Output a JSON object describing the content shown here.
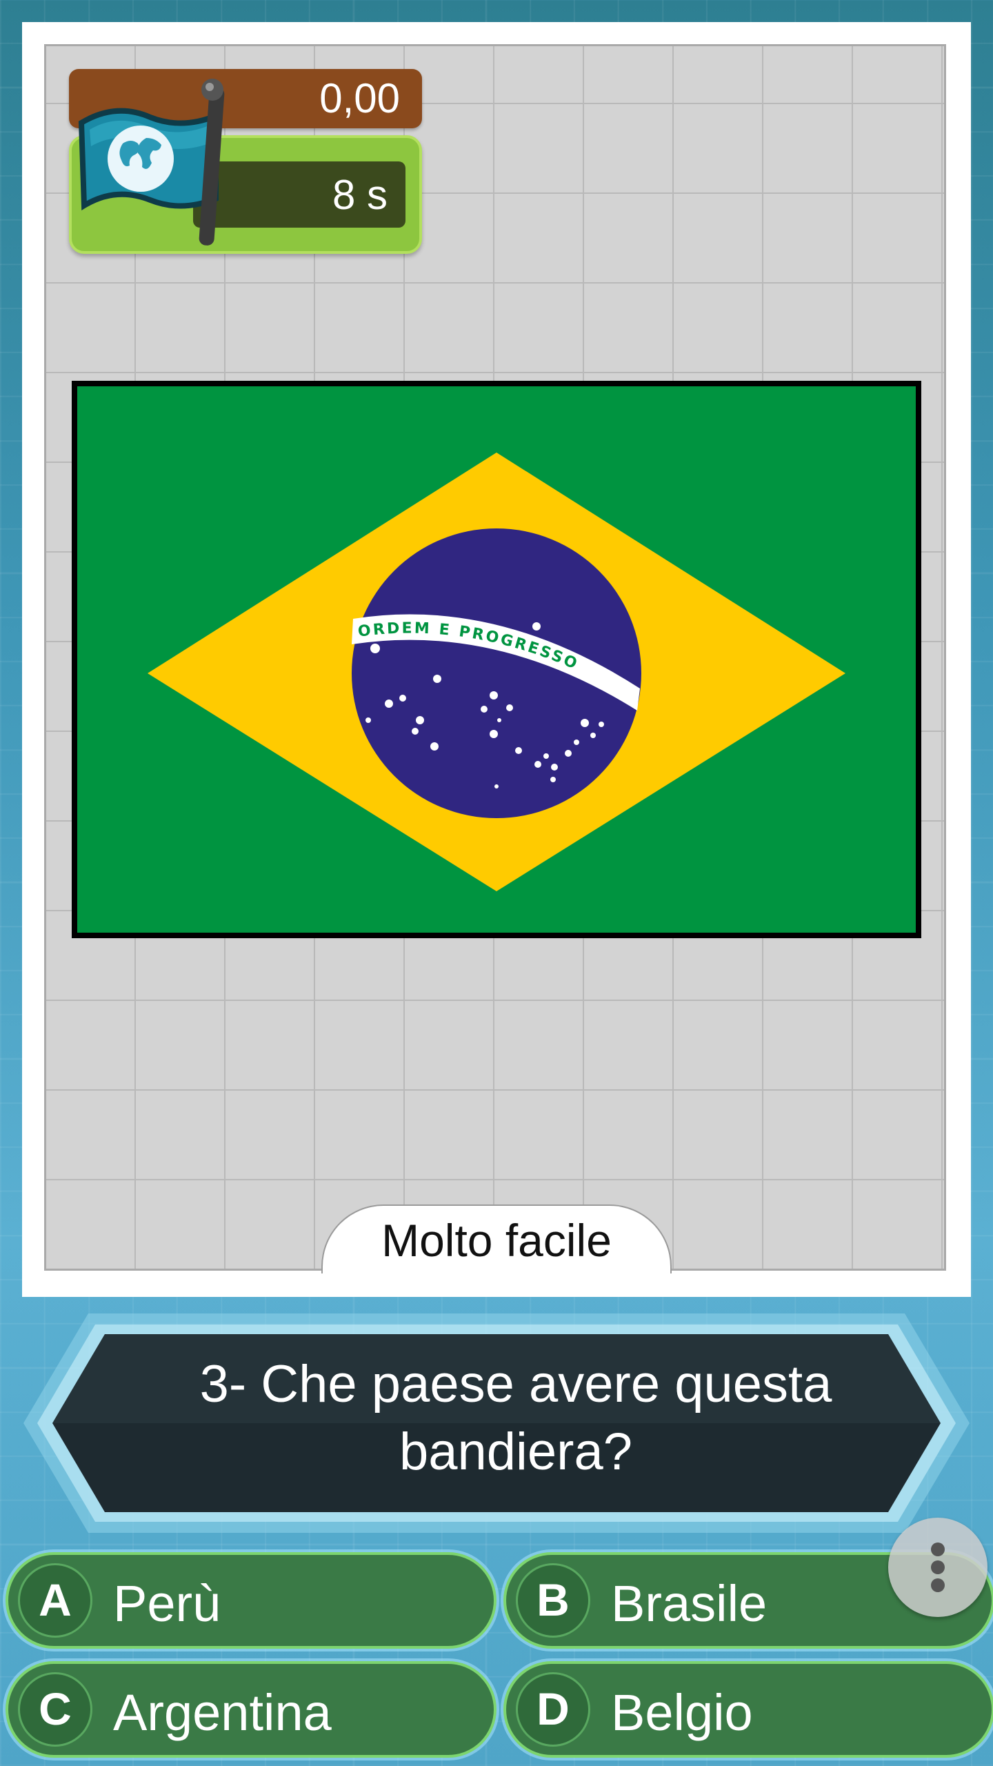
{
  "score": {
    "value": "0,00"
  },
  "timer": {
    "value": "8 s"
  },
  "flag": {
    "country_motto": "ORDEM E PROGRESSO",
    "colors": {
      "green": "#009440",
      "yellow": "#ffcb00",
      "blue": "#302681",
      "white": "#ffffff"
    }
  },
  "difficulty": {
    "label": "Molto facile"
  },
  "question": {
    "text": "3- Che paese avere questa bandiera?"
  },
  "answers": [
    {
      "letter": "A",
      "label": "Perù"
    },
    {
      "letter": "B",
      "label": "Brasile"
    },
    {
      "letter": "C",
      "label": "Argentina"
    },
    {
      "letter": "D",
      "label": "Belgio"
    }
  ],
  "icons": {
    "globe_flag": "globe-flag-icon",
    "menu": "more-vertical-icon"
  }
}
